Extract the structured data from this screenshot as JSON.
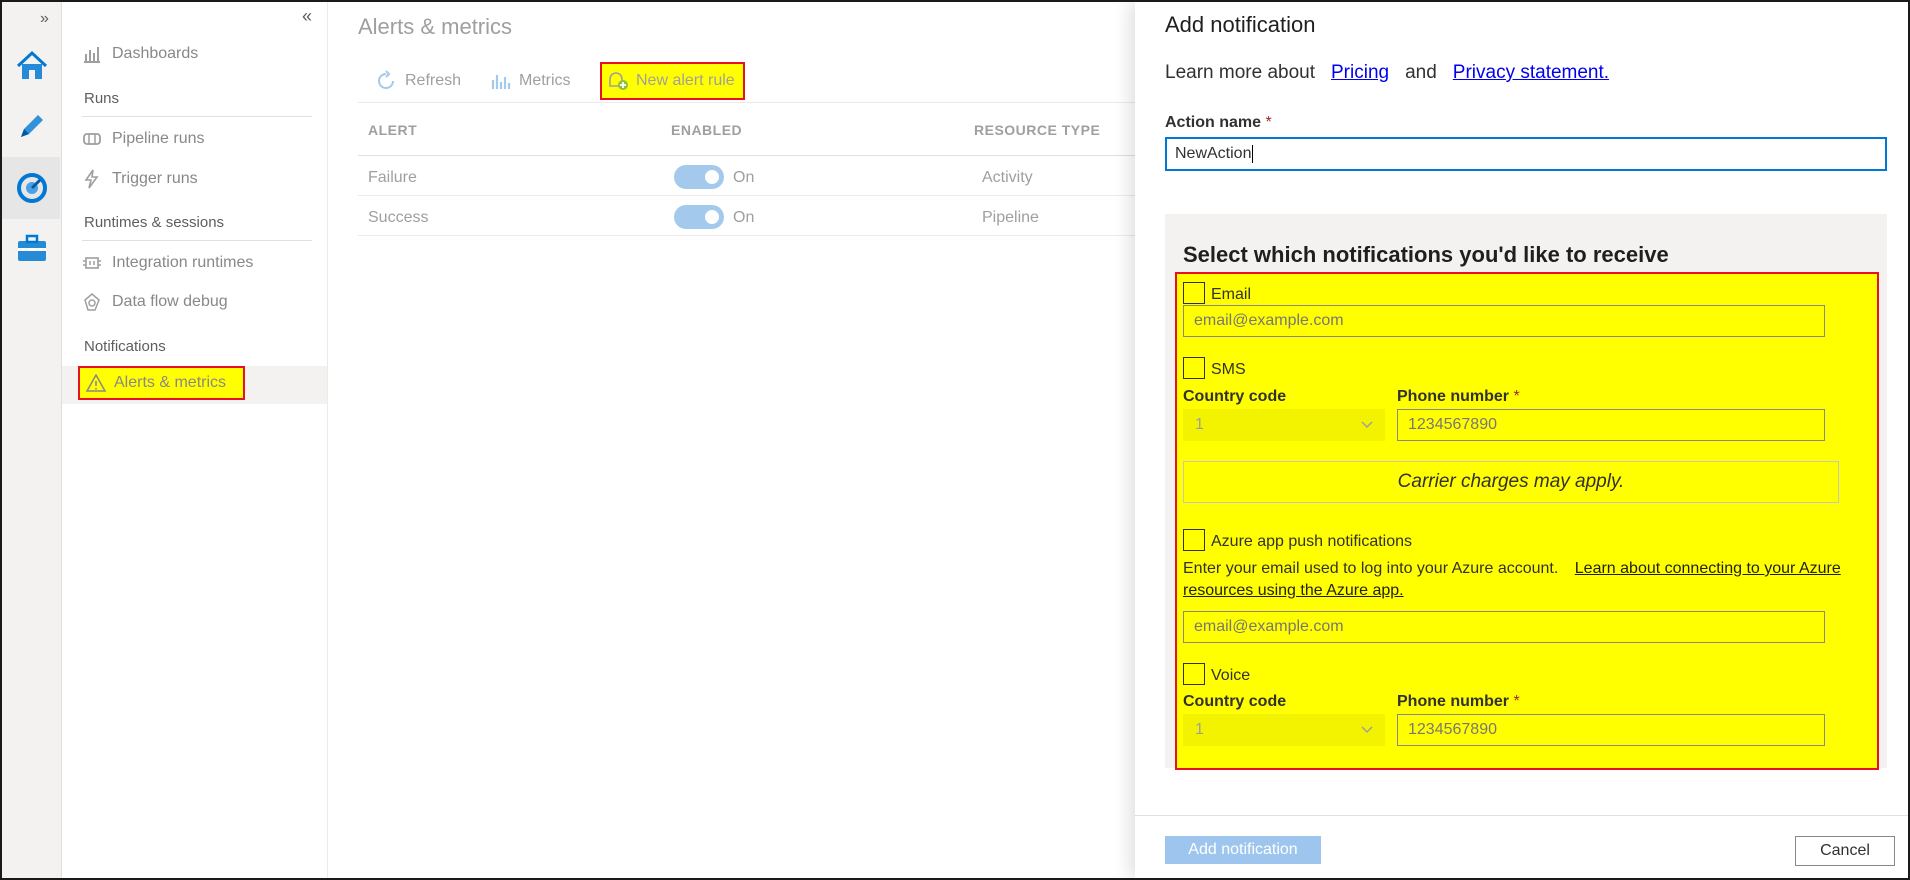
{
  "rail": {
    "expand_glyph": "»",
    "icons": [
      "home-icon",
      "pencil-icon",
      "monitor-gauge-icon",
      "toolbox-icon"
    ],
    "accent": "#0078d4"
  },
  "nav": {
    "collapse_glyph": "«",
    "dashboards": "Dashboards",
    "runs_header": "Runs",
    "pipeline_runs": "Pipeline runs",
    "trigger_runs": "Trigger runs",
    "runtimes_header": "Runtimes & sessions",
    "integration_runtimes": "Integration runtimes",
    "data_flow_debug": "Data flow debug",
    "notifications_header": "Notifications",
    "alerts_metrics": "Alerts & metrics"
  },
  "main": {
    "title": "Alerts & metrics",
    "toolbar": {
      "refresh": "Refresh",
      "metrics": "Metrics",
      "new_alert_rule": "New alert rule"
    },
    "table": {
      "headers": [
        "ALERT",
        "ENABLED",
        "RESOURCE TYPE"
      ],
      "rows": [
        {
          "alert": "Failure",
          "enabled": "On",
          "resource_type": "Activity"
        },
        {
          "alert": "Success",
          "enabled": "On",
          "resource_type": "Pipeline"
        }
      ]
    }
  },
  "panel": {
    "title": "Add notification",
    "learn_prefix": "Learn more about",
    "pricing_link": "Pricing",
    "and_text": "and",
    "privacy_link": "Privacy statement.",
    "action_name_label": "Action name",
    "required_mark": "*",
    "action_name_value": "NewAction",
    "section_title": "Select which notifications you'd like to receive",
    "email": {
      "label": "Email",
      "placeholder": "email@example.com"
    },
    "sms": {
      "label": "SMS",
      "country_code_label": "Country code",
      "country_code_value": "1",
      "phone_label": "Phone number",
      "phone_placeholder": "1234567890",
      "carrier_note": "Carrier charges may apply."
    },
    "push": {
      "label": "Azure app push notifications",
      "hint": "Enter your email used to log into your Azure account.",
      "hint_link": "Learn about connecting to your Azure resources using the Azure app.",
      "placeholder": "email@example.com"
    },
    "voice": {
      "label": "Voice",
      "country_code_label": "Country code",
      "country_code_value": "1",
      "phone_label": "Phone number",
      "phone_placeholder": "1234567890"
    },
    "add_button": "Add notification",
    "cancel_button": "Cancel"
  },
  "highlight_color": "#ffff00",
  "highlight_border": "#e81123"
}
